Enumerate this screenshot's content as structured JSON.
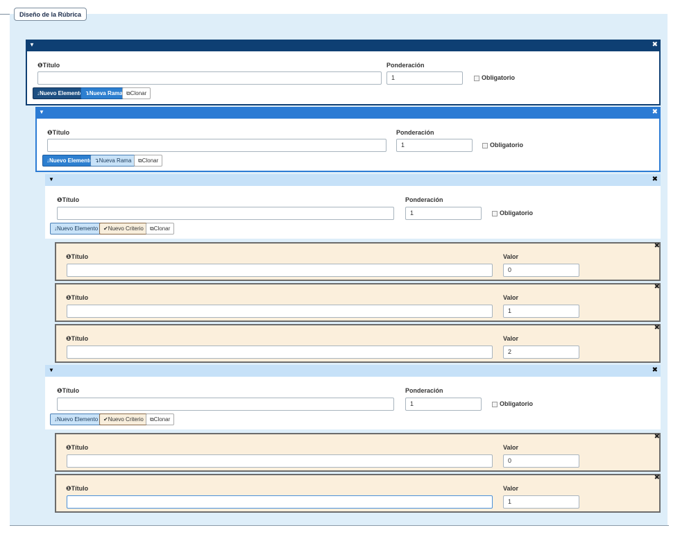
{
  "legend": "Diseño de la Rúbrica",
  "labels": {
    "titulo": "Título",
    "ponderacion": "Ponderación",
    "obligatorio": "Obligatorio",
    "valor": "Valor"
  },
  "icons": {
    "caret": "caret-down-icon",
    "close": "close-icon",
    "info": "info-icon",
    "down_arrow": "arrow-down-icon",
    "branch": "branch-arrow-icon",
    "check": "check-circle-icon",
    "copy": "copy-icon"
  },
  "buttons": {
    "nuevo_elemento": "Nuevo Elemento",
    "nueva_rama": "Nueva Rama",
    "clonar": "Clonar",
    "nuevo_criterio": "Nuevo Criterio"
  },
  "branch1": {
    "titulo": "",
    "ponderacion": "1"
  },
  "branch2": {
    "titulo": "",
    "ponderacion": "1"
  },
  "element1": {
    "titulo": "",
    "ponderacion": "1"
  },
  "element1_criteria": [
    {
      "titulo": "",
      "valor": "0"
    },
    {
      "titulo": "",
      "valor": "1"
    },
    {
      "titulo": "",
      "valor": "2"
    }
  ],
  "element2": {
    "titulo": "",
    "ponderacion": "1"
  },
  "element2_criteria": [
    {
      "titulo": "",
      "valor": "0"
    },
    {
      "titulo": "",
      "valor": "1"
    }
  ],
  "colors": {
    "level1_bar": "#0e3f73",
    "level2_bar": "#2b7bd4",
    "level3_bar": "#c6e1f8",
    "criterion_bg": "#fbefdc",
    "fieldset_bg": "#deeef9"
  }
}
